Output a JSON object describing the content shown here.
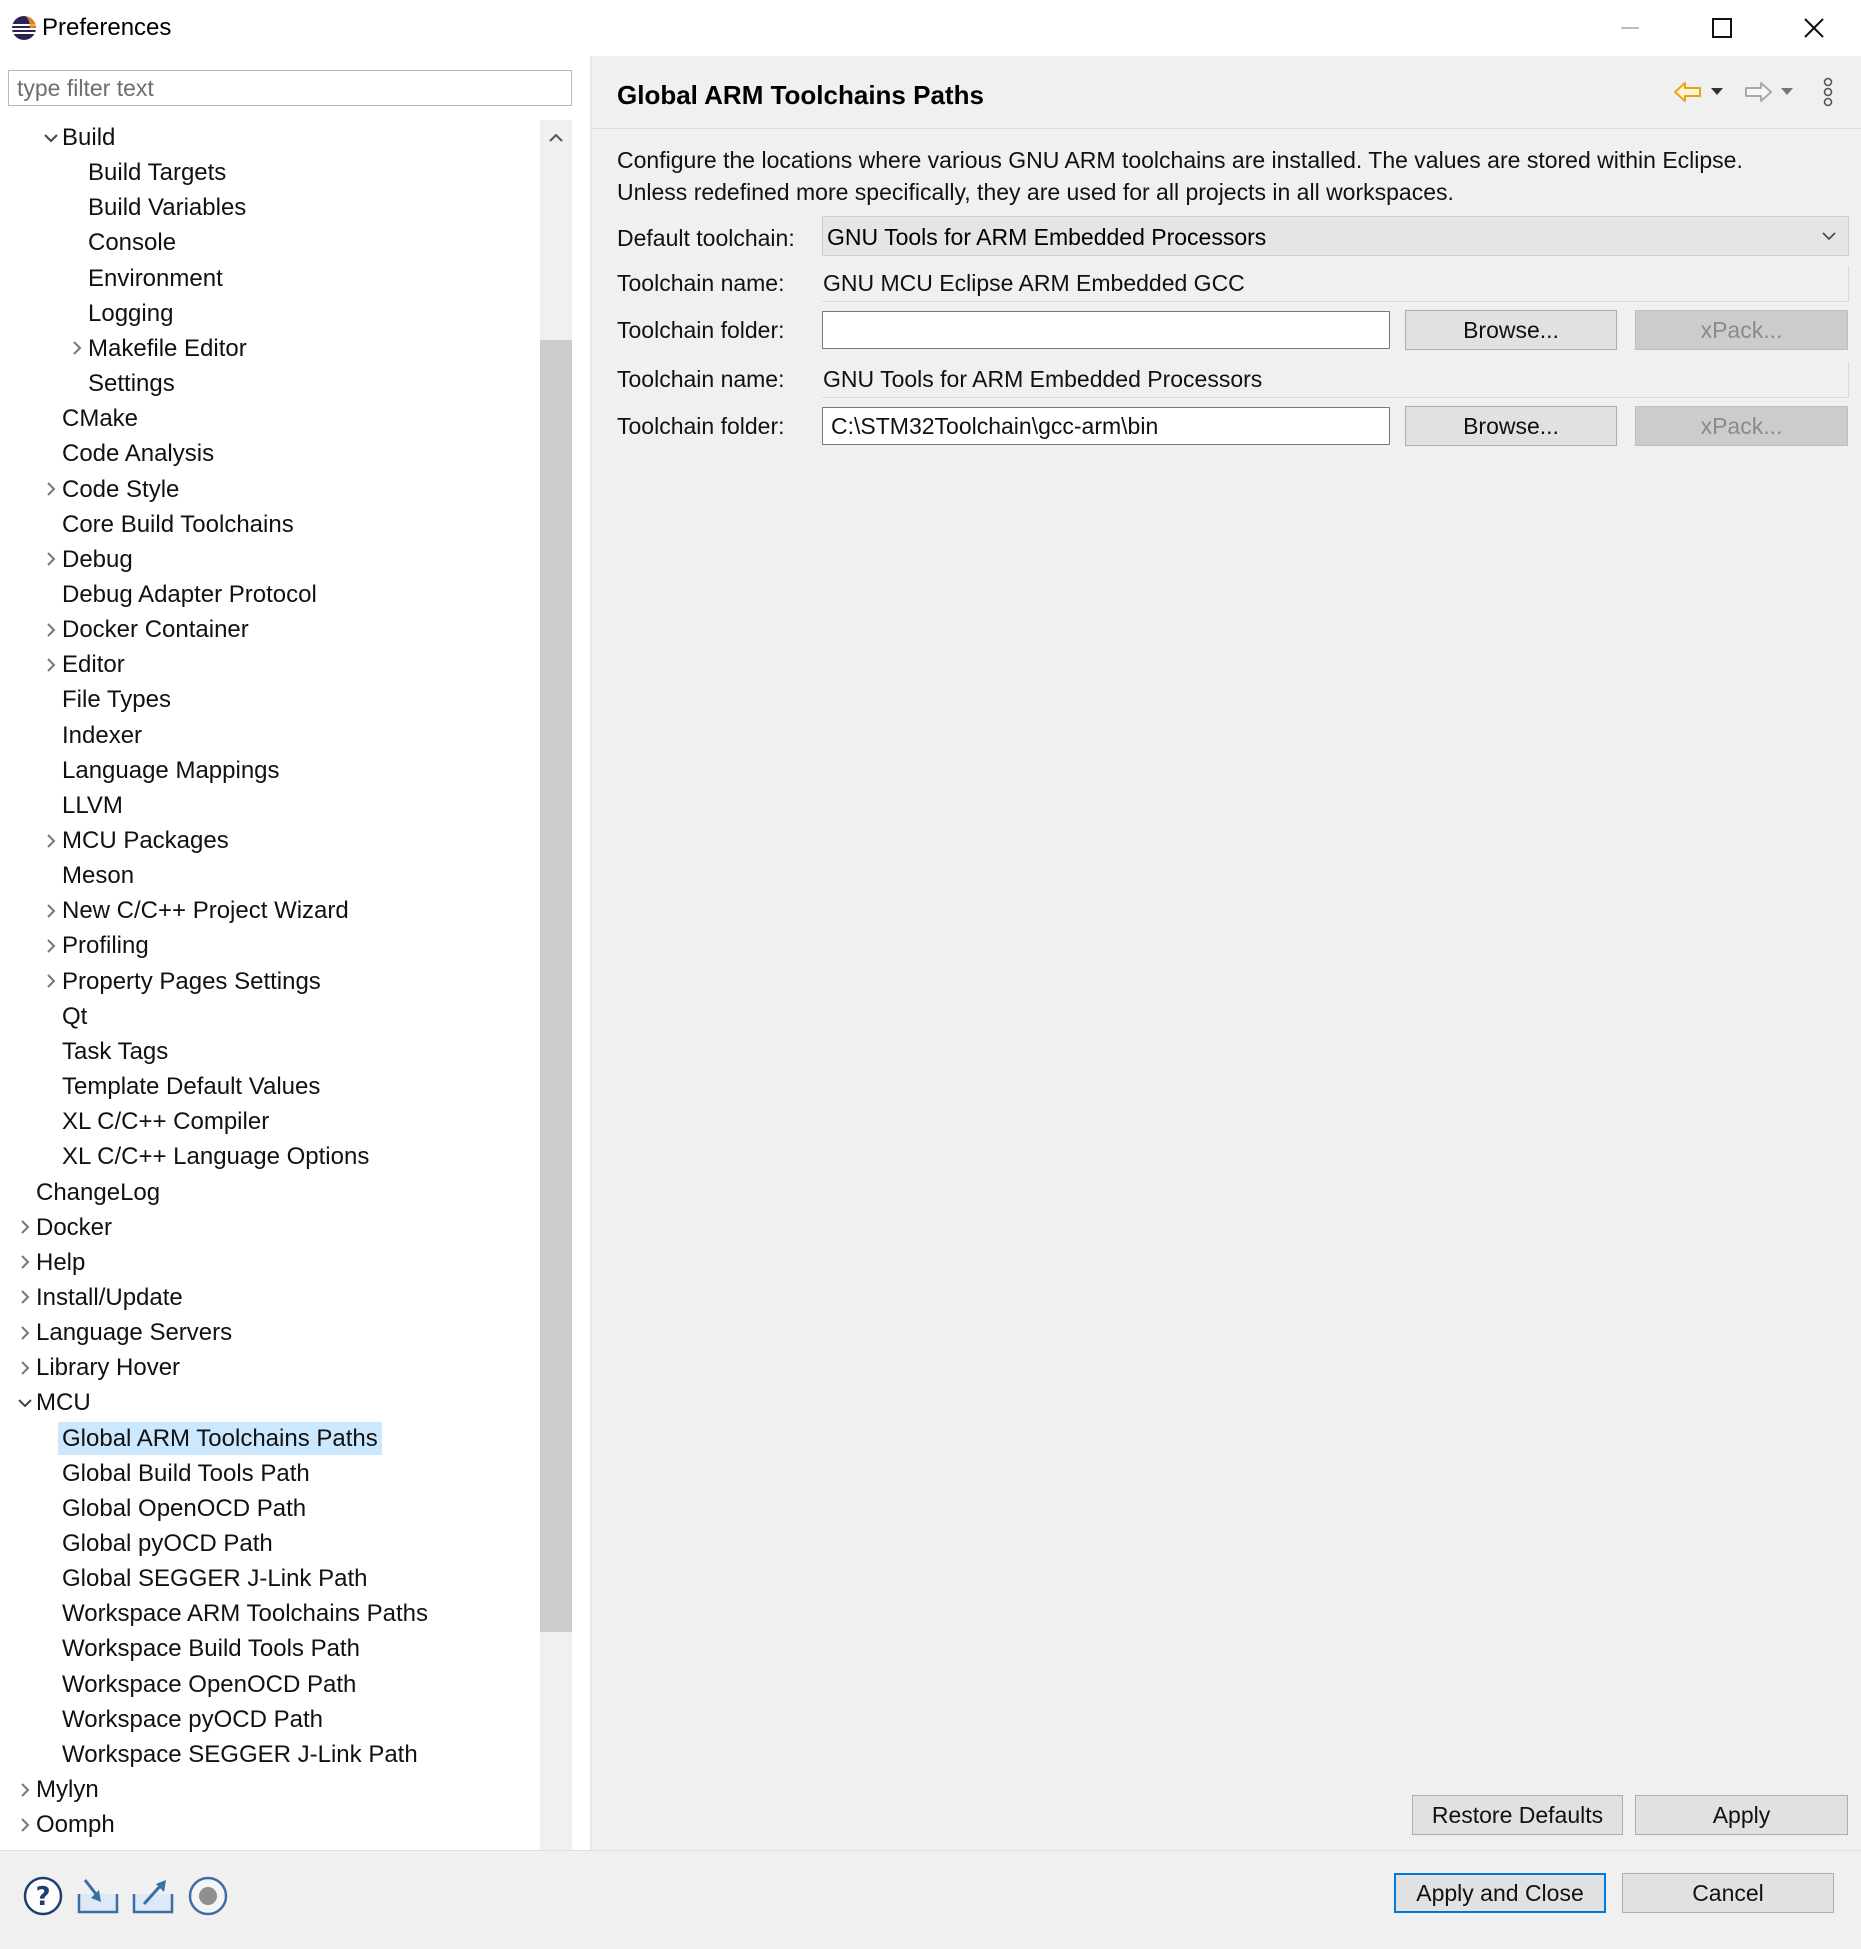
{
  "window": {
    "title": "Preferences"
  },
  "filter": {
    "placeholder": "type filter text"
  },
  "tree": {
    "items": [
      {
        "label": "Build",
        "expander": "expanded"
      },
      {
        "label": "Build Targets",
        "expander": "none"
      },
      {
        "label": "Build Variables",
        "expander": "none"
      },
      {
        "label": "Console",
        "expander": "none"
      },
      {
        "label": "Environment",
        "expander": "none"
      },
      {
        "label": "Logging",
        "expander": "none"
      },
      {
        "label": "Makefile Editor",
        "expander": "collapsed"
      },
      {
        "label": "Settings",
        "expander": "none"
      },
      {
        "label": "CMake",
        "expander": "none"
      },
      {
        "label": "Code Analysis",
        "expander": "none"
      },
      {
        "label": "Code Style",
        "expander": "collapsed"
      },
      {
        "label": "Core Build Toolchains",
        "expander": "none"
      },
      {
        "label": "Debug",
        "expander": "collapsed"
      },
      {
        "label": "Debug Adapter Protocol",
        "expander": "none"
      },
      {
        "label": "Docker Container",
        "expander": "collapsed"
      },
      {
        "label": "Editor",
        "expander": "collapsed"
      },
      {
        "label": "File Types",
        "expander": "none"
      },
      {
        "label": "Indexer",
        "expander": "none"
      },
      {
        "label": "Language Mappings",
        "expander": "none"
      },
      {
        "label": "LLVM",
        "expander": "none"
      },
      {
        "label": "MCU Packages",
        "expander": "collapsed"
      },
      {
        "label": "Meson",
        "expander": "none"
      },
      {
        "label": "New C/C++ Project Wizard",
        "expander": "collapsed"
      },
      {
        "label": "Profiling",
        "expander": "collapsed"
      },
      {
        "label": "Property Pages Settings",
        "expander": "collapsed"
      },
      {
        "label": "Qt",
        "expander": "none"
      },
      {
        "label": "Task Tags",
        "expander": "none"
      },
      {
        "label": "Template Default Values",
        "expander": "none"
      },
      {
        "label": "XL C/C++ Compiler",
        "expander": "none"
      },
      {
        "label": "XL C/C++ Language Options",
        "expander": "none"
      },
      {
        "label": "ChangeLog",
        "expander": "none"
      },
      {
        "label": "Docker",
        "expander": "collapsed"
      },
      {
        "label": "Help",
        "expander": "collapsed"
      },
      {
        "label": "Install/Update",
        "expander": "collapsed"
      },
      {
        "label": "Language Servers",
        "expander": "collapsed"
      },
      {
        "label": "Library Hover",
        "expander": "collapsed"
      },
      {
        "label": "MCU",
        "expander": "expanded"
      },
      {
        "label": "Global ARM Toolchains Paths",
        "expander": "none",
        "selected": true
      },
      {
        "label": "Global Build Tools Path",
        "expander": "none"
      },
      {
        "label": "Global OpenOCD Path",
        "expander": "none"
      },
      {
        "label": "Global pyOCD Path",
        "expander": "none"
      },
      {
        "label": "Global SEGGER J-Link Path",
        "expander": "none"
      },
      {
        "label": "Workspace ARM Toolchains Paths",
        "expander": "none"
      },
      {
        "label": "Workspace Build Tools Path",
        "expander": "none"
      },
      {
        "label": "Workspace OpenOCD Path",
        "expander": "none"
      },
      {
        "label": "Workspace pyOCD Path",
        "expander": "none"
      },
      {
        "label": "Workspace SEGGER J-Link Path",
        "expander": "none"
      },
      {
        "label": "Mylyn",
        "expander": "collapsed"
      },
      {
        "label": "Oomph",
        "expander": "collapsed"
      }
    ]
  },
  "page": {
    "title": "Global ARM Toolchains Paths",
    "description_line1": "Configure the locations where various GNU ARM toolchains are installed. The values are stored within Eclipse.",
    "description_line2": "Unless redefined more specifically, they are used for all projects in all workspaces.",
    "default_toolchain_label": "Default toolchain:",
    "default_toolchain_value": "GNU Tools for ARM Embedded Processors",
    "toolchains": [
      {
        "name_label": "Toolchain name:",
        "name_value": "GNU MCU Eclipse ARM Embedded GCC",
        "folder_label": "Toolchain folder:",
        "folder_value": "",
        "browse_label": "Browse...",
        "xpack_label": "xPack..."
      },
      {
        "name_label": "Toolchain name:",
        "name_value": "GNU Tools for ARM Embedded Processors",
        "folder_label": "Toolchain folder:",
        "folder_value": "C:\\STM32Toolchain\\gcc-arm\\bin",
        "browse_label": "Browse...",
        "xpack_label": "xPack..."
      }
    ],
    "restore_defaults_label": "Restore Defaults",
    "apply_label": "Apply"
  },
  "footer": {
    "apply_close_label": "Apply and Close",
    "cancel_label": "Cancel",
    "icons": [
      "help-icon",
      "import-icon",
      "export-icon",
      "record-icon"
    ]
  },
  "colors": {
    "selection": "#cce8ff",
    "nav_back_arrow": "#e8a317",
    "default_button_border": "#0078d7",
    "content_background": "#f0f0f0"
  }
}
